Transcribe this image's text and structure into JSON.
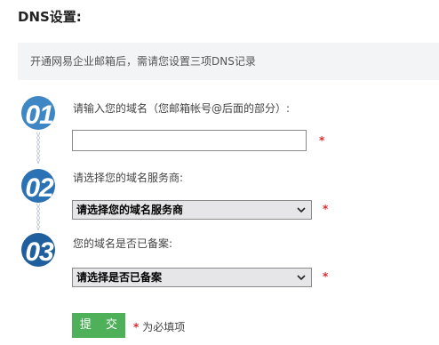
{
  "page": {
    "title": "DNS设置:"
  },
  "notice": {
    "text": "开通网易企业邮箱后，需请您设置三项DNS记录"
  },
  "steps": [
    {
      "number": "01",
      "label": "请输入您的域名（您邮箱帐号@后面的部分）:",
      "color": "#3e86c4"
    },
    {
      "number": "02",
      "label": "请选择您的域名服务商:",
      "color": "#2a72b4"
    },
    {
      "number": "03",
      "label": "您的域名是否已备案:",
      "color": "#1f5f9e"
    }
  ],
  "domain_input": {
    "value": "",
    "placeholder": ""
  },
  "provider_select": {
    "selected": "请选择您的域名服务商"
  },
  "filing_select": {
    "selected": "请选择是否已备案"
  },
  "required_mark": "*",
  "submit": {
    "label": "提 交"
  },
  "required_note": {
    "star": "*",
    "text": "为必填项"
  },
  "icons": {
    "step_connector": "chevron-down-chain-icon",
    "dropdown": "chevron-down-icon"
  }
}
